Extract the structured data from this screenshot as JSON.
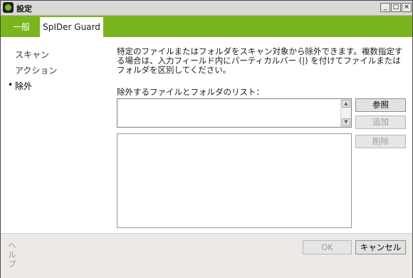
{
  "window": {
    "title": "設定",
    "controls": {
      "minimize": "_",
      "maximize": "□",
      "close": "×"
    }
  },
  "tabs": [
    {
      "label": "一般",
      "active": false
    },
    {
      "label": "SpIDer Guard",
      "active": true
    }
  ],
  "sidebar": {
    "items": [
      {
        "label": "スキャン",
        "active": false
      },
      {
        "label": "アクション",
        "active": false
      },
      {
        "label": "除外",
        "active": true
      }
    ],
    "bullet": "•"
  },
  "main": {
    "description": "特定のファイルまたはフォルダをスキャン対象から除外できます。複数指定する場合は、入力フィールド内にパーティカルバー (|) を付けてファイルまたはフォルダを区別してください。",
    "list_label": "除外するファイルとフォルダのリスト：",
    "input_value": "",
    "exclusion_list": [],
    "buttons": {
      "browse": "参照",
      "add": "追加",
      "delete": "削除"
    },
    "scroll_up": "▲",
    "scroll_down": "▼"
  },
  "footer": {
    "help": "ヘルプ",
    "ok": "OK",
    "cancel": "キャンセル"
  },
  "colors": {
    "accent": "#7ab51d"
  },
  "icons": {
    "app": "drweb-shield-icon"
  }
}
